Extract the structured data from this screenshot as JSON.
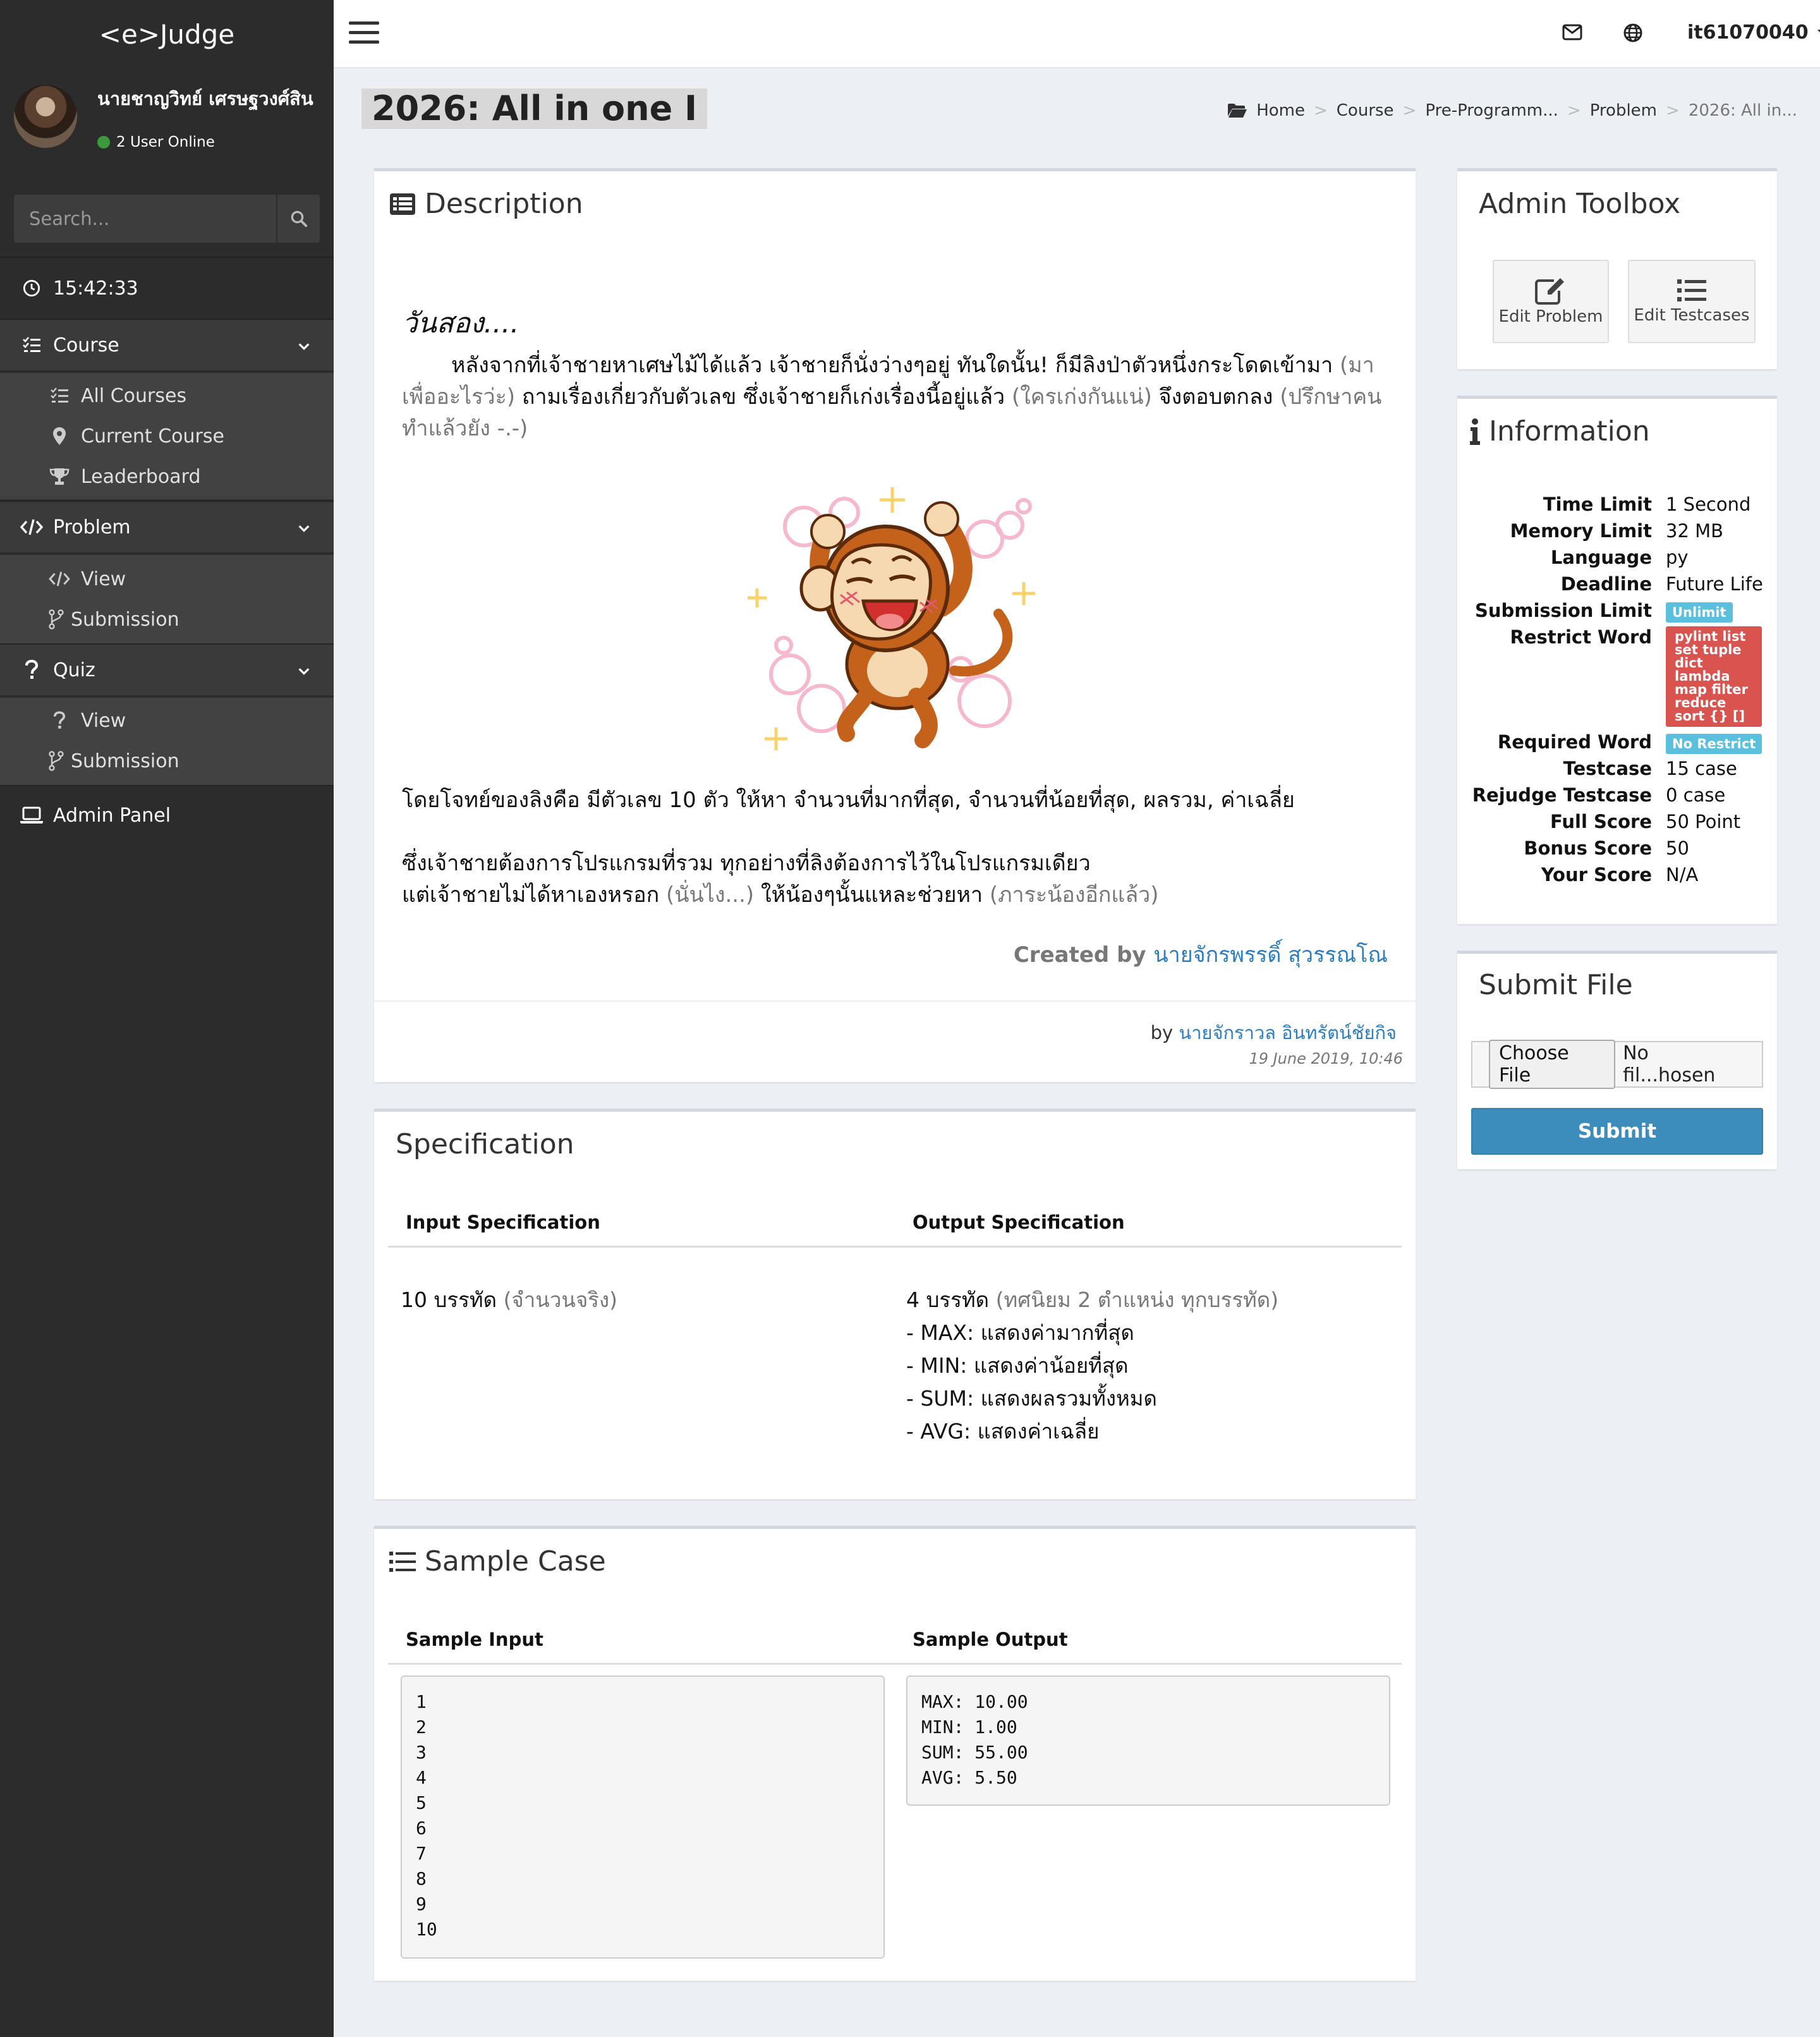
{
  "brand": "<e>Judge",
  "user": {
    "name": "นายชาญวิทย์ เศรษฐวงศ์สิน",
    "online": "2 User Online"
  },
  "search": {
    "placeholder": "Search..."
  },
  "clock": "15:42:33",
  "sidebar": {
    "course": {
      "label": "Course",
      "items": [
        "All Courses",
        "Current Course",
        "Leaderboard"
      ]
    },
    "problem": {
      "label": "Problem",
      "items": [
        "View",
        "Submission"
      ]
    },
    "quiz": {
      "label": "Quiz",
      "items": [
        "View",
        "Submission"
      ]
    },
    "admin": "Admin Panel"
  },
  "topbar": {
    "username": "it61070040"
  },
  "page": {
    "title": "2026: All in one I"
  },
  "breadcrumb": [
    "Home",
    "Course",
    "Pre-Programm...",
    "Problem",
    "2026: All in..."
  ],
  "description": {
    "title": "Description",
    "heading": "วันสอง....",
    "p1_a": "หลังจากที่เจ้าชายหาเศษไม้ได้แล้ว เจ้าชายก็นั่งว่างๆอยู่ ทันใดนั้น! ก็มีลิงป่าตัวหนึ่งกระโดดเข้ามา ",
    "p1_b": "(มาเพื่ออะไรว่ะ)",
    "p1_c": " ถามเรื่องเกี่ยวกับตัวเลข ซึ่งเจ้าชายก็เก่งเรื่องนี้อยู่แล้ว ",
    "p1_d": "(ใครเก่งกันแน่)",
    "p1_e": " จึงตอบตกลง ",
    "p1_f": "(ปรึกษาคนทำแล้วยัง -.-)",
    "p2": "โดยโจทย์ของลิงคือ มีตัวเลข 10 ตัว ให้หา จำนวนที่มากที่สุด, จำนวนที่น้อยที่สุด, ผลรวม, ค่าเฉลี่ย",
    "p3": "ซึ่งเจ้าชายต้องการโปรแกรมที่รวม ทุกอย่างที่ลิงต้องการไว้ในโปรแกรมเดียว",
    "p4_a": "แต่เจ้าชายไม่ได้หาเองหรอก ",
    "p4_b": "(นั่นไง...)",
    "p4_c": " ให้น้องๆนั้นแหละช่วยหา ",
    "p4_d": "(ภาระน้องอีกแล้ว)",
    "created_label": "Created by",
    "created_name": "นายจักรพรรดิ์ สุวรรณโณ",
    "by_label": "by",
    "by_name": "นายจักราวล อินทรัตน์ชัยกิจ",
    "date": "19 June 2019, 10:46"
  },
  "specification": {
    "title": "Specification",
    "input_header": "Input Specification",
    "output_header": "Output Specification",
    "input_main": "10 บรรทัด",
    "input_note": "(จำนวนจริง)",
    "output_main": "4 บรรทัด",
    "output_note": "(ทศนิยม 2 ตำแหน่ง ทุกบรรทัด)",
    "output_lines": [
      "- MAX: แสดงค่ามากที่สุด",
      "- MIN: แสดงค่าน้อยที่สุด",
      "- SUM: แสดงผลรวมทั้งหมด",
      "- AVG: แสดงค่าเฉลี่ย"
    ]
  },
  "sample": {
    "title": "Sample Case",
    "input_header": "Sample Input",
    "output_header": "Sample Output",
    "input": "1\n2\n3\n4\n5\n6\n7\n8\n9\n10",
    "output": "MAX: 10.00\nMIN: 1.00\nSUM: 55.00\nAVG: 5.50"
  },
  "admin_toolbox": {
    "title": "Admin Toolbox",
    "edit_problem": "Edit Problem",
    "edit_testcases": "Edit Testcases"
  },
  "information": {
    "title": "Information",
    "time_limit_label": "Time Limit",
    "time_limit": "1 Second",
    "memory_limit_label": "Memory Limit",
    "memory_limit": "32 MB",
    "language_label": "Language",
    "language": "py",
    "deadline_label": "Deadline",
    "deadline": "Future Life",
    "submission_limit_label": "Submission Limit",
    "submission_limit": "Unlimit",
    "restrict_word_label": "Restrict Word",
    "restrict_word": "pylint list set tuple dict lambda map filter reduce sort {} []",
    "required_word_label": "Required Word",
    "required_word": "No Restrict",
    "testcase_label": "Testcase",
    "testcase": "15 case",
    "rejudge_label": "Rejudge Testcase",
    "rejudge": "0 case",
    "full_score_label": "Full Score",
    "full_score": "50 Point",
    "bonus_label": "Bonus Score",
    "bonus": "50",
    "your_score_label": "Your Score",
    "your_score": "N/A"
  },
  "submit_file": {
    "title": "Submit File",
    "choose": "Choose File",
    "file_status": "No fil...hosen",
    "submit": "Submit"
  },
  "colors": {
    "accent": "#3c8dbc",
    "sidebar": "#2c2c2c",
    "badge_info": "#5bc0de",
    "badge_danger": "#d9534f",
    "link": "#2a7ec1"
  }
}
